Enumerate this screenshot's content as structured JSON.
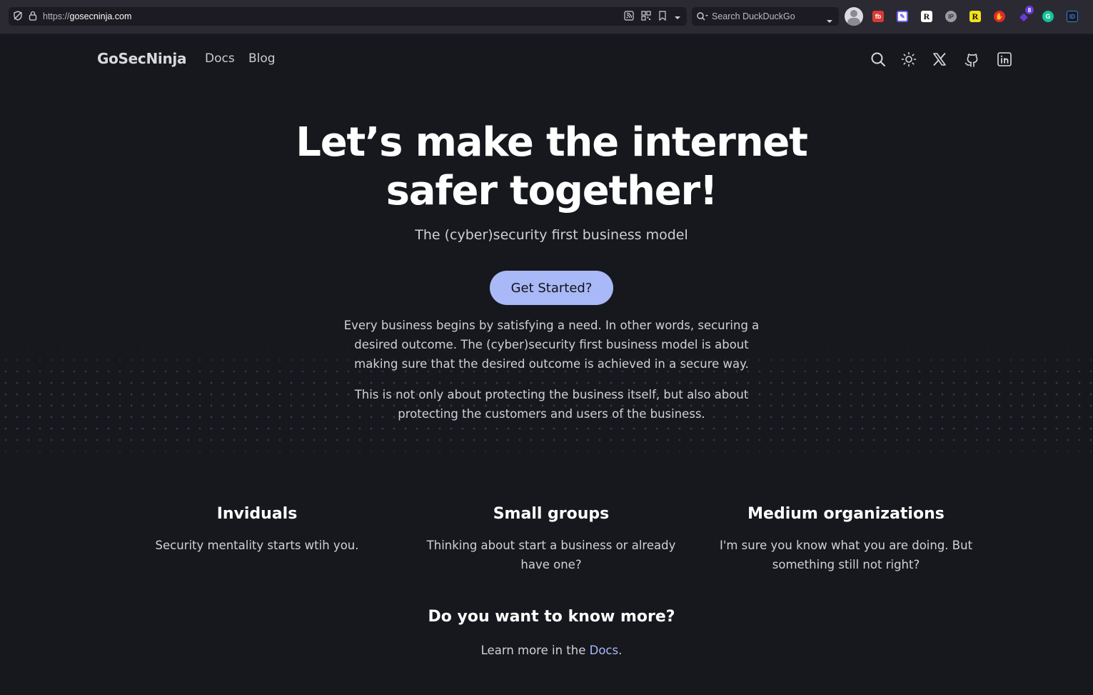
{
  "browser": {
    "url_scheme": "https://",
    "url_host": "gosecninja.com",
    "search_placeholder": "Search DuckDuckGo",
    "extensions": [
      {
        "name": "profile-avatar",
        "label": ""
      },
      {
        "name": "todoist-extension",
        "label": "fb",
        "color": "#d83a34"
      },
      {
        "name": "notes-extension",
        "label": "✎",
        "color": "#6c63ff"
      },
      {
        "name": "readwise-extension",
        "label": "R",
        "color": "#ffffff"
      },
      {
        "name": "ip-extension",
        "label": "IP",
        "color": "#9a9aa2"
      },
      {
        "name": "readability-extension",
        "label": "R",
        "color": "#f2e21b"
      },
      {
        "name": "stop-extension",
        "label": "✋",
        "color": "#e02a2a"
      },
      {
        "name": "tags-extension",
        "label": "◆",
        "color": "#6a3bd8",
        "badge": "8"
      },
      {
        "name": "grammarly-extension",
        "label": "G",
        "color": "#15c39a"
      },
      {
        "name": "id-extension",
        "label": "ID",
        "color": "#3a7bd5"
      }
    ]
  },
  "nav": {
    "brand": "GoSecNinja",
    "links": [
      "Docs",
      "Blog"
    ]
  },
  "hero": {
    "title": "Let’s make the internet safer together!",
    "subtitle": "The (cyber)security first business model",
    "cta_label": "Get Started?",
    "paragraph_1": "Every business begins by satisfying a need. In other words, securing a desired outcome. The (cyber)security first business model is about making sure that the desired outcome is achieved in a secure way.",
    "paragraph_2": "This is not only about protecting the business itself, but also about protecting the customers and users of the business."
  },
  "features": [
    {
      "title": "Inviduals",
      "text": "Security mentality starts wtih you."
    },
    {
      "title": "Small groups",
      "text": "Thinking about start a business or already have one?"
    },
    {
      "title": "Medium organizations",
      "text": "I'm sure you know what you are doing. But something still not right?"
    }
  ],
  "more": {
    "title": "Do you want to know more?",
    "text_before": "Learn more in the ",
    "link_label": "Docs",
    "text_after": "."
  },
  "colors": {
    "background": "#17181d",
    "accent": "#a9b8f7",
    "browser_chrome": "#2b2a33"
  }
}
